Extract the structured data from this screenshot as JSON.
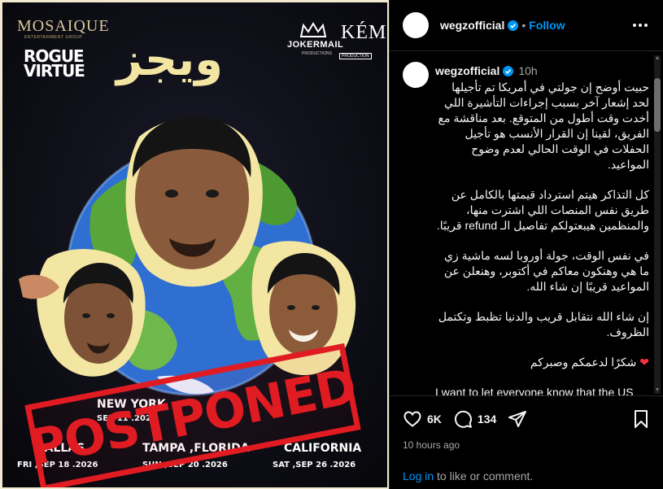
{
  "post": {
    "username": "wegzofficial",
    "follow_label": "Follow",
    "header_separator": "•",
    "time_ago_short": "10h",
    "caption_paragraphs": [
      "حبيت أوضح إن جولتي في أمريكا تم تأجيلها لحد إشعار آخر بسبب إجراءات التأشيرة اللي أخدت وقت أطول من المتوقع. بعد مناقشة مع الفريق، لقينا إن القرار الأنسب هو تأجيل الحفلات في الوقت الحالي لعدم وضوح المواعيد.",
      "كل التذاكر هيتم استرداد قيمتها بالكامل عن طريق نفس المنصات اللي اشترت منها، والمنظمين هيبعتولكم تفاصيل الـ refund قريبًا.",
      "في نفس الوقت، جولة أوروبا لسه ماشية زي ما هي وهنكون معاكم في أكتوبر، وهنعلن عن المواعيد قريبًا إن شاء الله.",
      "إن شاء الله نتقابل قريب والدنيا تظبط وتكتمل الظروف.",
      "شكرًا لدعمكم وصبركم"
    ],
    "heart_emoji": "❤",
    "caption_english": "I want to let everyone know that the US",
    "likes": "6K",
    "comments": "134",
    "time_ago_long": "10 hours ago",
    "login_link": "Log in",
    "login_rest": " to like or comment."
  },
  "poster": {
    "brand_mosaique": "MOSAIQUE",
    "brand_mosaique_sub": "ENTERTAINMENT GROUP",
    "brand_rogue_line1": "ROGUE",
    "brand_rogue_line2": "VIRTUE",
    "brand_jokermail": "JOKERMAIL",
    "brand_jokermail_sub": "PRODUCTIONS",
    "brand_keme": "KÉME",
    "brand_keme_sub": "PRODUCTION",
    "arabic_title": "ويجز",
    "stamp_text": "POSTPONED",
    "shows": [
      {
        "city": "NEW YORK",
        "date": "SEP 11 .2026"
      },
      {
        "city": "",
        "date": ""
      },
      {
        "city": "DALLAS",
        "date": "FRI ,SEP 18 .2026"
      },
      {
        "city": "TAMPA ,FLORIDA",
        "date": "SUN ,SEP 20 .2026"
      },
      {
        "city": "CALIFORNIA",
        "date": "SAT ,SEP 26 .2026"
      }
    ]
  },
  "colors": {
    "accent_blue": "#0095f6",
    "stamp_red": "#e11b22",
    "poster_gold": "#f3e6a3",
    "globe_ocean": "#2f6fd1",
    "globe_land": "#58a63a"
  },
  "icons": [
    "verified-badge-icon",
    "more-options-icon",
    "heart-icon",
    "comment-icon",
    "share-icon",
    "bookmark-icon"
  ]
}
